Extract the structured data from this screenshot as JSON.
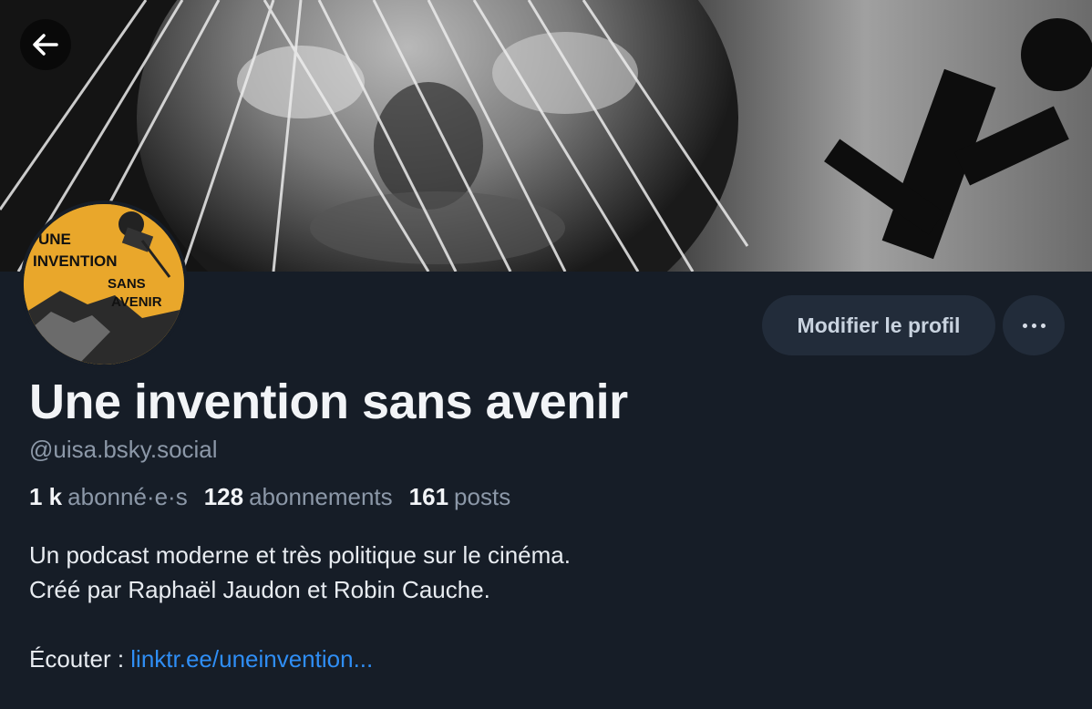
{
  "nav": {
    "back_icon": "arrow-left-icon"
  },
  "avatar": {
    "text_line1": "UNE",
    "text_line2": "INVENTION",
    "text_line3": "SANS",
    "text_line4": "AVENIR",
    "background_color": "#e9a72b"
  },
  "actions": {
    "edit_label": "Modifier le profil",
    "more_icon": "more-horizontal-icon"
  },
  "profile": {
    "display_name": "Une invention sans avenir",
    "handle": "@uisa.bsky.social"
  },
  "stats": {
    "followers_count": "1 k",
    "followers_label": "abonné·e·s",
    "following_count": "128",
    "following_label": "abonnements",
    "posts_count": "161",
    "posts_label": "posts"
  },
  "bio": {
    "line1": "Un podcast moderne et très politique sur le cinéma.",
    "line2": "Créé par Raphaël Jaudon et Robin Cauche.",
    "listen_prefix": "Écouter : ",
    "link_text": "linktr.ee/uneinvention..."
  },
  "colors": {
    "page_background": "#161d27",
    "button_background": "#222c3a",
    "link": "#2f8ef5",
    "muted_text": "#8c98a8"
  }
}
